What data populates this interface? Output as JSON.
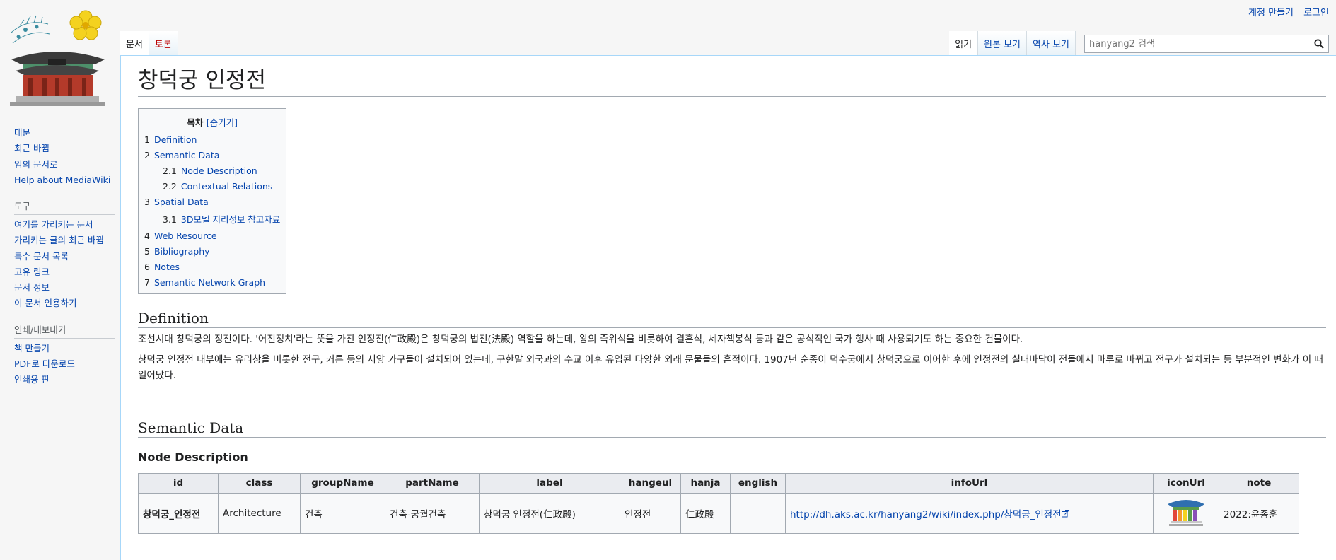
{
  "personal": {
    "create_account": "계정 만들기",
    "login": "로그인"
  },
  "tabs": {
    "left": [
      {
        "label": "문서"
      },
      {
        "label": "토론"
      }
    ],
    "right": [
      {
        "label": "읽기"
      },
      {
        "label": "원본 보기"
      },
      {
        "label": "역사 보기"
      }
    ]
  },
  "search": {
    "placeholder": "hanyang2 검색"
  },
  "sidebar": {
    "nav": [
      "대문",
      "최근 바뀜",
      "임의 문서로",
      "Help about MediaWiki"
    ],
    "tools": {
      "title": "도구",
      "items": [
        "여기를 가리키는 문서",
        "가리키는 글의 최근 바뀜",
        "특수 문서 목록",
        "고유 링크",
        "문서 정보",
        "이 문서 인용하기"
      ]
    },
    "print": {
      "title": "인쇄/내보내기",
      "items": [
        "책 만들기",
        "PDF로 다운로드",
        "인쇄용 판"
      ]
    }
  },
  "page": {
    "title": "창덕궁 인정전",
    "toc": {
      "title": "목차",
      "hide": "[숨기기]",
      "items": [
        {
          "num": "1",
          "label": "Definition"
        },
        {
          "num": "2",
          "label": "Semantic Data"
        },
        {
          "num": "2.1",
          "label": "Node Description"
        },
        {
          "num": "2.2",
          "label": "Contextual Relations"
        },
        {
          "num": "3",
          "label": "Spatial Data"
        },
        {
          "num": "3.1",
          "label": "3D모델 지리정보 참고자료"
        },
        {
          "num": "4",
          "label": "Web Resource"
        },
        {
          "num": "5",
          "label": "Bibliography"
        },
        {
          "num": "6",
          "label": "Notes"
        },
        {
          "num": "7",
          "label": "Semantic Network Graph"
        }
      ]
    },
    "definition": {
      "heading": "Definition",
      "para1": "조선시대 창덕궁의 정전이다. '어진정치'라는 뜻을 가진 인정전(仁政殿)은 창덕궁의 법전(法殿) 역할을 하는데, 왕의 즉위식을 비롯하여 결혼식, 세자책봉식 등과 같은 공식적인 국가 행사 때 사용되기도 하는 중요한 건물이다.",
      "para2": "창덕궁 인정전 내부에는 유리창을 비롯한 전구, 커튼 등의 서양 가구들이 설치되어 있는데, 구한말 외국과의 수교 이후 유입된 다양한 외래 문물들의 흔적이다. 1907년 순종이 덕수궁에서 창덕궁으로 이어한 후에 인정전의 실내바닥이 전돌에서 마루로 바뀌고 전구가 설치되는 등 부분적인 변화가 이 때 일어났다."
    },
    "semantic": {
      "heading": "Semantic Data",
      "node_heading": "Node Description",
      "columns": [
        "id",
        "class",
        "groupName",
        "partName",
        "label",
        "hangeul",
        "hanja",
        "english",
        "infoUrl",
        "iconUrl",
        "note"
      ],
      "row": {
        "id": "창덕궁_인정전",
        "class": "Architecture",
        "groupName": "건축",
        "partName": "건축-궁궐건축",
        "label": "창덕궁 인정전(仁政殿)",
        "hangeul": "인정전",
        "hanja": "仁政殿",
        "english": "",
        "infoUrl": "http://dh.aks.ac.kr/hanyang2/wiki/index.php/창덕궁_인정전",
        "note": "2022:윤종훈"
      }
    }
  },
  "icons": {
    "logo": "palace-plum-logo",
    "search": "search-icon",
    "external": "external-link-icon",
    "row_icon": "palace-gate-icon"
  },
  "colors": {
    "link": "#0645ad",
    "new_link": "#ba0000",
    "border_blue": "#a7d7f9"
  }
}
